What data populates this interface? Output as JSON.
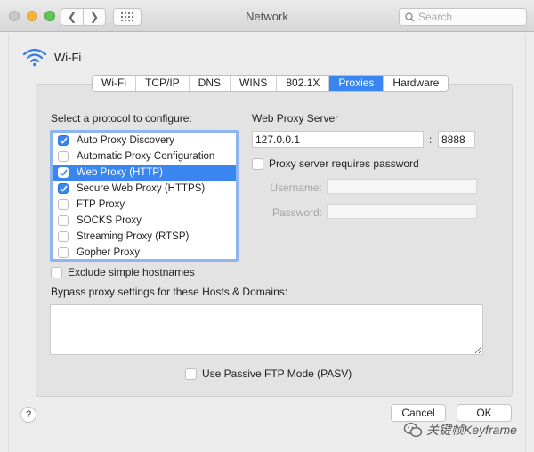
{
  "window": {
    "title": "Network",
    "search_placeholder": "Search"
  },
  "interface": {
    "name": "Wi-Fi",
    "icon": "wifi-icon"
  },
  "tabs": [
    {
      "label": "Wi-Fi",
      "active": false
    },
    {
      "label": "TCP/IP",
      "active": false
    },
    {
      "label": "DNS",
      "active": false
    },
    {
      "label": "WINS",
      "active": false
    },
    {
      "label": "802.1X",
      "active": false
    },
    {
      "label": "Proxies",
      "active": true
    },
    {
      "label": "Hardware",
      "active": false
    }
  ],
  "protocols": {
    "heading": "Select a protocol to configure:",
    "items": [
      {
        "label": "Auto Proxy Discovery",
        "checked": true,
        "selected": false
      },
      {
        "label": "Automatic Proxy Configuration",
        "checked": false,
        "selected": false
      },
      {
        "label": "Web Proxy (HTTP)",
        "checked": true,
        "selected": true
      },
      {
        "label": "Secure Web Proxy (HTTPS)",
        "checked": true,
        "selected": false
      },
      {
        "label": "FTP Proxy",
        "checked": false,
        "selected": false
      },
      {
        "label": "SOCKS Proxy",
        "checked": false,
        "selected": false
      },
      {
        "label": "Streaming Proxy (RTSP)",
        "checked": false,
        "selected": false
      },
      {
        "label": "Gopher Proxy",
        "checked": false,
        "selected": false
      }
    ]
  },
  "proxy_server": {
    "heading": "Web Proxy Server",
    "host": "127.0.0.1",
    "separator": ":",
    "port": "8888",
    "requires_password_label": "Proxy server requires password",
    "requires_password": false,
    "username_label": "Username:",
    "password_label": "Password:"
  },
  "exclude_simple_hostnames": {
    "label": "Exclude simple hostnames",
    "checked": false
  },
  "bypass": {
    "label": "Bypass proxy settings for these Hosts & Domains:",
    "value": ""
  },
  "passive_ftp": {
    "label": "Use Passive FTP Mode (PASV)",
    "checked": false
  },
  "buttons": {
    "help": "?",
    "cancel": "Cancel",
    "ok": "OK"
  },
  "watermark": "关键帧Keyframe",
  "colors": {
    "accent": "#3a86f0"
  }
}
